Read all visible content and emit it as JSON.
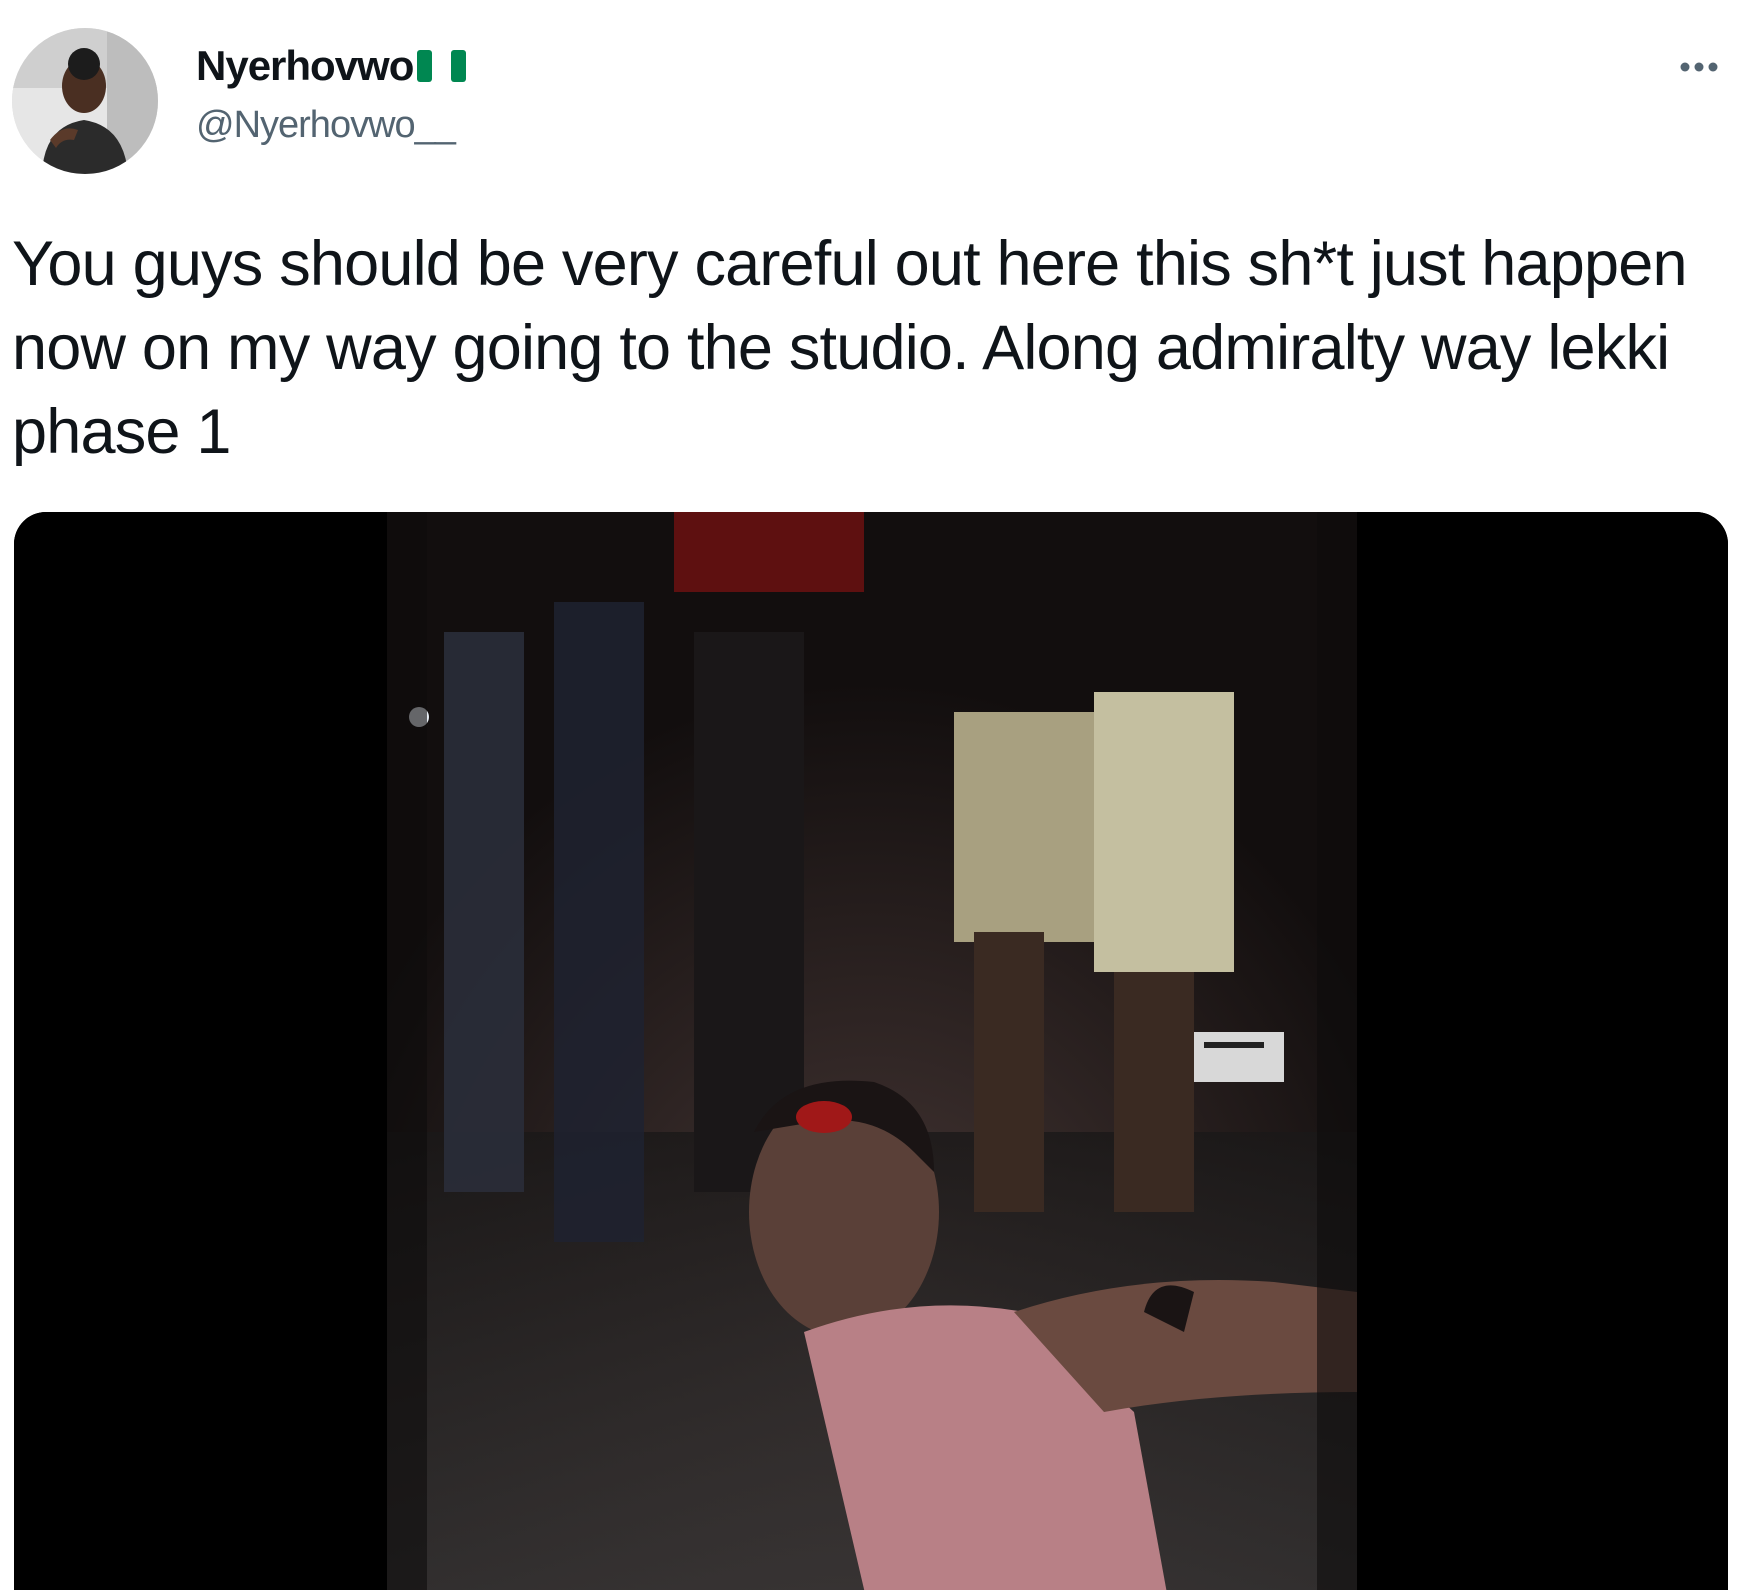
{
  "tweet": {
    "author": {
      "display_name": "Nyerhovwo",
      "handle": "@Nyerhovwo__",
      "avatar_icon": "profile-photo",
      "flag_icon": "nigeria-flag-icon",
      "flag_colors": [
        "#008751",
        "#ffffff",
        "#008751"
      ]
    },
    "more_icon": "more-options-icon",
    "text": "You guys should be very careful out here this sh*t just happen now on my way going to the studio. Along admiralty way lekki phase 1",
    "media": {
      "kind": "video-still",
      "icon": "embedded-video-frame"
    }
  },
  "colors": {
    "text_primary": "#0f1419",
    "text_secondary": "#536471",
    "media_background": "#000000"
  }
}
